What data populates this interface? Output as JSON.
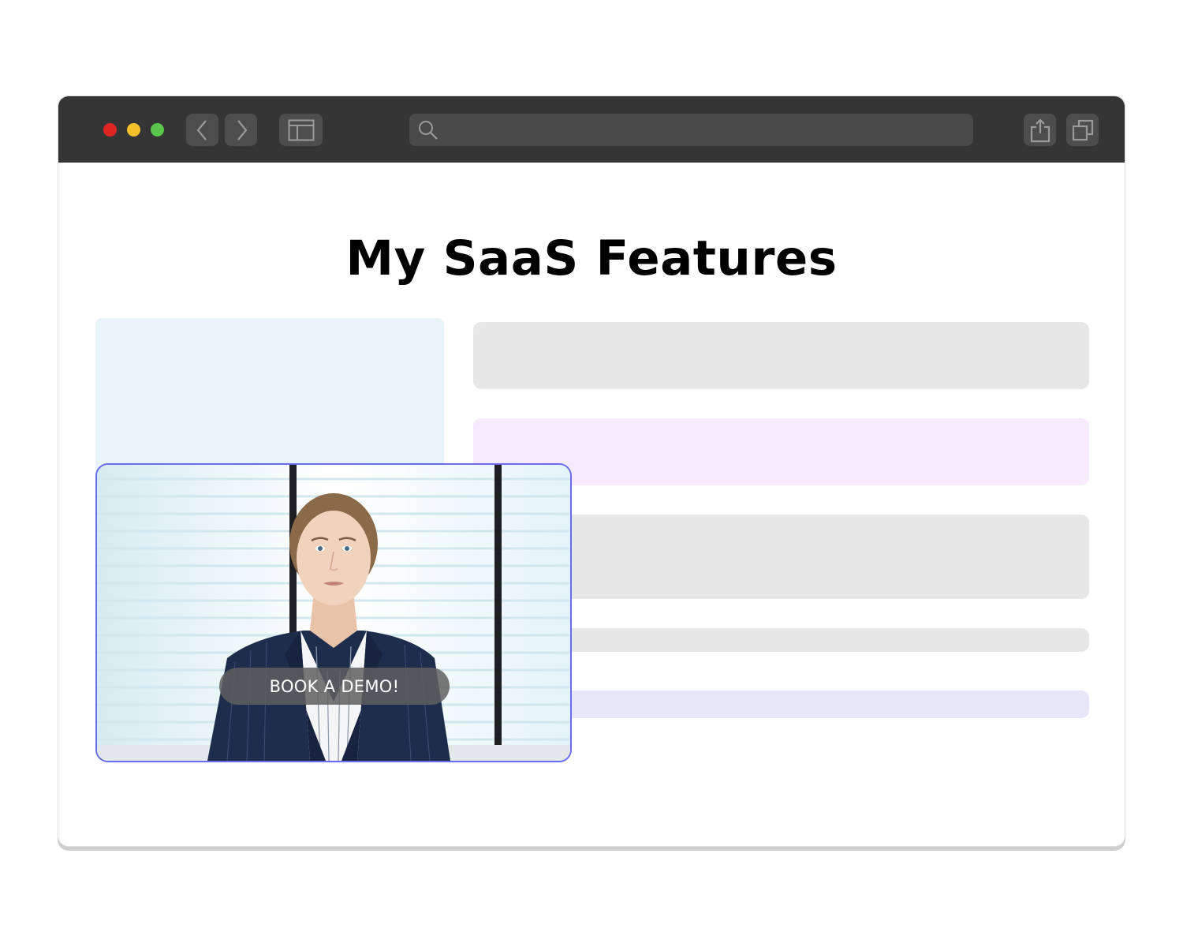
{
  "window": {
    "traffic_lights": [
      "close",
      "minimize",
      "maximize"
    ],
    "colors": {
      "chrome": "#353535",
      "close": "#e02520",
      "minimize": "#f3c12a",
      "maximize": "#5ac64c"
    },
    "toolbar_icons": [
      "chevron-left-icon",
      "chevron-right-icon",
      "sidebar-icon",
      "search-icon",
      "share-icon",
      "tabs-icon"
    ],
    "address_bar": {
      "value": ""
    }
  },
  "page": {
    "title": "My SaaS Features",
    "video": {
      "cta_label": "BOOK A DEMO!",
      "border_color": "#6a6cf0"
    }
  }
}
